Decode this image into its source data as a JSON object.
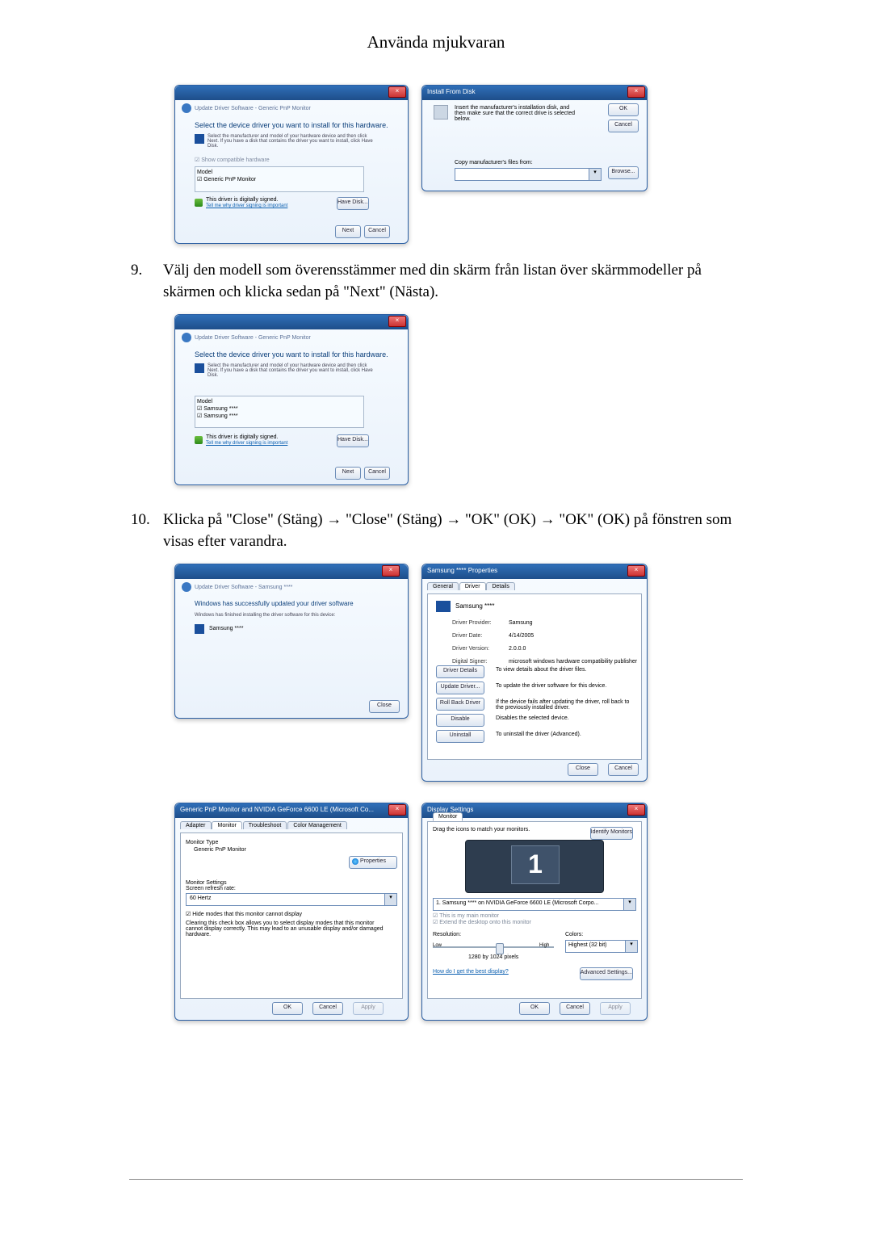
{
  "header": {
    "title": "Använda mjukvaran"
  },
  "steps": {
    "s9": {
      "num": "9.",
      "text": "Välj den modell som överensstämmer med din skärm från listan över skärmmodeller på skärmen och klicka sedan på \"Next\" (Nästa)."
    },
    "s10": {
      "num": "10.",
      "text": "Klicka på \"Close\" (Stäng) → \"Close\" (Stäng) → \"OK\" (OK) → \"OK\" (OK) på fönstren som visas efter varandra."
    }
  },
  "win_update1": {
    "crumb": "Update Driver Software - Generic PnP Monitor",
    "heading": "Select the device driver you want to install for this hardware.",
    "hint": "Select the manufacturer and model of your hardware device and then click Next. If you have a disk that contains the driver you want to install, click Have Disk.",
    "show_compat": "Show compatible hardware",
    "model_hdr": "Model",
    "model1": "Generic PnP Monitor",
    "signed": "This driver is digitally signed.",
    "signed_link": "Tell me why driver signing is important",
    "have_disk": "Have Disk...",
    "next": "Next",
    "cancel": "Cancel"
  },
  "win_install": {
    "title": "Install From Disk",
    "msg": "Insert the manufacturer's installation disk, and then make sure that the correct drive is selected below.",
    "ok": "OK",
    "cancel": "Cancel",
    "copy_lbl": "Copy manufacturer's files from:",
    "browse": "Browse..."
  },
  "win_update2": {
    "crumb": "Update Driver Software - Generic PnP Monitor",
    "heading": "Select the device driver you want to install for this hardware.",
    "hint": "Select the manufacturer and model of your hardware device and then click Next. If you have a disk that contains the driver you want to install, click Have Disk.",
    "model_hdr": "Model",
    "model1": "Samsung ****",
    "model2": "Samsung ****",
    "signed": "This driver is digitally signed.",
    "signed_link": "Tell me why driver signing is important",
    "have_disk": "Have Disk...",
    "next": "Next",
    "cancel": "Cancel"
  },
  "win_done": {
    "crumb": "Update Driver Software - Samsung ****",
    "heading": "Windows has successfully updated your driver software",
    "hint": "Windows has finished installing the driver software for this device:",
    "name": "Samsung ****",
    "close": "Close"
  },
  "win_prop": {
    "title": "Samsung **** Properties",
    "tabs": {
      "general": "General",
      "driver": "Driver",
      "details": "Details"
    },
    "name": "Samsung ****",
    "fields": {
      "provider_lbl": "Driver Provider:",
      "provider_val": "Samsung",
      "date_lbl": "Driver Date:",
      "date_val": "4/14/2005",
      "version_lbl": "Driver Version:",
      "version_val": "2.0.0.0",
      "signer_lbl": "Digital Signer:",
      "signer_val": "microsoft windows hardware compatibility publisher"
    },
    "buttons": {
      "details": "Driver Details",
      "details_desc": "To view details about the driver files.",
      "update": "Update Driver...",
      "update_desc": "To update the driver software for this device.",
      "rollback": "Roll Back Driver",
      "rollback_desc": "If the device fails after updating the driver, roll back to the previously installed driver.",
      "disable": "Disable",
      "disable_desc": "Disables the selected device.",
      "uninstall": "Uninstall",
      "uninstall_desc": "To uninstall the driver (Advanced)."
    },
    "ok": "Close",
    "cancel": "Cancel"
  },
  "win_monprop": {
    "title": "Generic PnP Monitor and NVIDIA GeForce 6600 LE (Microsoft Co...",
    "tabs": {
      "adapter": "Adapter",
      "monitor": "Monitor",
      "troubleshoot": "Troubleshoot",
      "color": "Color Management"
    },
    "type_lbl": "Monitor Type",
    "type_val": "Generic PnP Monitor",
    "properties": "Properties",
    "settings_lbl": "Monitor Settings",
    "refresh_lbl": "Screen refresh rate:",
    "refresh_val": "60 Hertz",
    "hide_chk": "Hide modes that this monitor cannot display",
    "note": "Clearing this check box allows you to select display modes that this monitor cannot display correctly. This may lead to an unusable display and/or damaged hardware.",
    "ok": "OK",
    "cancel": "Cancel",
    "apply": "Apply"
  },
  "win_disp": {
    "title": "Display Settings",
    "tab": "Monitor",
    "drag": "Drag the icons to match your monitors.",
    "identify": "Identify Monitors",
    "combo": "1. Samsung **** on NVIDIA GeForce 6600 LE (Microsoft Corpo...",
    "chk1": "This is my main monitor",
    "chk2": "Extend the desktop onto this monitor",
    "res_lbl": "Resolution:",
    "low": "Low",
    "high": "High",
    "res_val": "1280 by 1024 pixels",
    "col_lbl": "Colors:",
    "col_val": "Highest (32 bit)",
    "link": "How do I get the best display?",
    "adv": "Advanced Settings...",
    "ok": "OK",
    "cancel": "Cancel",
    "apply": "Apply"
  }
}
